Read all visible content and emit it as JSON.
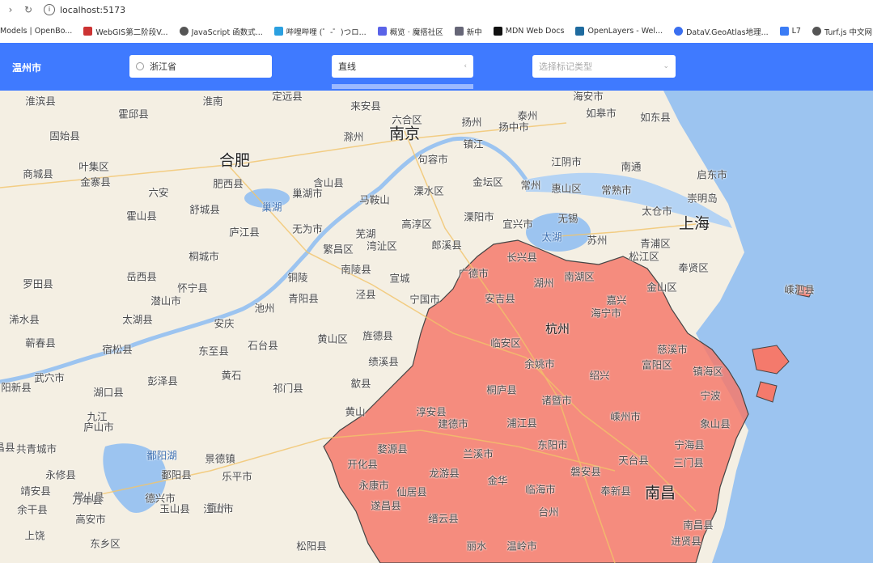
{
  "browser": {
    "url": "localhost:5173",
    "bookmarks": [
      "Models | OpenBo...",
      "WebGIS第二阶段V...",
      "JavaScript 函数式...",
      "哔哩哔哩 (゜-゜)つロ...",
      "概览 · 魔搭社区",
      "新中",
      "MDN Web Docs",
      "OpenLayers - Wel...",
      "DataV.GeoAtlas地理...",
      "L7",
      "Turf.js 中文网"
    ]
  },
  "header": {
    "city": "温州市",
    "search_value": "浙江省",
    "draw_type": "直线",
    "mark_placeholder": "选择标记类型"
  },
  "map": {
    "highlight_region": "浙江省",
    "highlight_color": "#f47a6c",
    "sea_color": "#9cc4f0",
    "labels": [
      {
        "t": "淮滨县",
        "c": "s"
      },
      {
        "t": "淮南",
        "c": "s"
      },
      {
        "t": "定远县",
        "c": "s"
      },
      {
        "t": "来安县",
        "c": "s"
      },
      {
        "t": "六合区",
        "c": "s"
      },
      {
        "t": "泰州",
        "c": "s"
      },
      {
        "t": "海安市",
        "c": "s"
      },
      {
        "t": "霍邱县",
        "c": "s"
      },
      {
        "t": "扬州",
        "c": "s"
      },
      {
        "t": "如皋市",
        "c": "s"
      },
      {
        "t": "固始县",
        "c": "s"
      },
      {
        "t": "滁州",
        "c": "s"
      },
      {
        "t": "南京",
        "c": "b"
      },
      {
        "t": "扬中市",
        "c": "s"
      },
      {
        "t": "如东县",
        "c": "s"
      },
      {
        "t": "镇江",
        "c": "s"
      },
      {
        "t": "合肥",
        "c": "b"
      },
      {
        "t": "叶集区",
        "c": "s"
      },
      {
        "t": "句容市",
        "c": "s"
      },
      {
        "t": "江阴市",
        "c": "s"
      },
      {
        "t": "南通",
        "c": "s"
      },
      {
        "t": "商城县",
        "c": "s"
      },
      {
        "t": "金寨县",
        "c": "s"
      },
      {
        "t": "肥西县",
        "c": "s"
      },
      {
        "t": "含山县",
        "c": "s"
      },
      {
        "t": "金坛区",
        "c": "s"
      },
      {
        "t": "常州",
        "c": "s"
      },
      {
        "t": "惠山区",
        "c": "s"
      },
      {
        "t": "常熟市",
        "c": "s"
      },
      {
        "t": "启东市",
        "c": "s"
      },
      {
        "t": "六安",
        "c": "s"
      },
      {
        "t": "巢湖市",
        "c": "s"
      },
      {
        "t": "马鞍山",
        "c": "s"
      },
      {
        "t": "溧水区",
        "c": "s"
      },
      {
        "t": "崇明岛",
        "c": "s"
      },
      {
        "t": "巢湖",
        "c": "w"
      },
      {
        "t": "霍山县",
        "c": "s"
      },
      {
        "t": "舒城县",
        "c": "s"
      },
      {
        "t": "无为市",
        "c": "s"
      },
      {
        "t": "高淳区",
        "c": "s"
      },
      {
        "t": "溧阳市",
        "c": "s"
      },
      {
        "t": "宜兴市",
        "c": "s"
      },
      {
        "t": "无锡",
        "c": "s"
      },
      {
        "t": "太仓市",
        "c": "s"
      },
      {
        "t": "上海",
        "c": "b"
      },
      {
        "t": "芜湖",
        "c": "s"
      },
      {
        "t": "太湖",
        "c": "w"
      },
      {
        "t": "苏州",
        "c": "s"
      },
      {
        "t": "庐江县",
        "c": "s"
      },
      {
        "t": "繁昌区",
        "c": "s"
      },
      {
        "t": "湾沚区",
        "c": "s"
      },
      {
        "t": "郎溪县",
        "c": "s"
      },
      {
        "t": "青浦区",
        "c": "s"
      },
      {
        "t": "松江区",
        "c": "s"
      },
      {
        "t": "桐城市",
        "c": "s"
      },
      {
        "t": "长兴县",
        "c": "s"
      },
      {
        "t": "南湖区",
        "c": "s"
      },
      {
        "t": "奉贤区",
        "c": "s"
      },
      {
        "t": "南陵县",
        "c": "s"
      },
      {
        "t": "广德市",
        "c": "s"
      },
      {
        "t": "岳西县",
        "c": "s"
      },
      {
        "t": "铜陵",
        "c": "s"
      },
      {
        "t": "宣城",
        "c": "s"
      },
      {
        "t": "湖州",
        "c": "s"
      },
      {
        "t": "金山区",
        "c": "s"
      },
      {
        "t": "罗田县",
        "c": "s"
      },
      {
        "t": "怀宁县",
        "c": "s"
      },
      {
        "t": "潜山市",
        "c": "s"
      },
      {
        "t": "青阳县",
        "c": "s"
      },
      {
        "t": "泾县",
        "c": "s"
      },
      {
        "t": "宁国市",
        "c": "s"
      },
      {
        "t": "安吉县",
        "c": "s"
      },
      {
        "t": "嘉兴",
        "c": "s"
      },
      {
        "t": "嵊泗县",
        "c": "s"
      },
      {
        "t": "池州",
        "c": "s"
      },
      {
        "t": "海宁市",
        "c": "s"
      },
      {
        "t": "浠水县",
        "c": "s"
      },
      {
        "t": "太湖县",
        "c": "s"
      },
      {
        "t": "安庆",
        "c": "s"
      },
      {
        "t": "黄山区",
        "c": "s"
      },
      {
        "t": "旌德县",
        "c": "s"
      },
      {
        "t": "杭州",
        "c": "m"
      },
      {
        "t": "蕲春县",
        "c": "s"
      },
      {
        "t": "宿松县",
        "c": "s"
      },
      {
        "t": "东至县",
        "c": "s"
      },
      {
        "t": "石台县",
        "c": "s"
      },
      {
        "t": "临安区",
        "c": "s"
      },
      {
        "t": "慈溪市",
        "c": "s"
      },
      {
        "t": "绩溪县",
        "c": "s"
      },
      {
        "t": "富阳区",
        "c": "s"
      },
      {
        "t": "余姚市",
        "c": "s"
      },
      {
        "t": "绍兴",
        "c": "s"
      },
      {
        "t": "镇海区",
        "c": "s"
      },
      {
        "t": "黄石",
        "c": "s"
      },
      {
        "t": "武穴市",
        "c": "s"
      },
      {
        "t": "彭泽县",
        "c": "s"
      },
      {
        "t": "祁门县",
        "c": "s"
      },
      {
        "t": "歙县",
        "c": "s"
      },
      {
        "t": "阳新县",
        "c": "s"
      },
      {
        "t": "湖口县",
        "c": "s"
      },
      {
        "t": "桐庐县",
        "c": "s"
      },
      {
        "t": "诸暨市",
        "c": "s"
      },
      {
        "t": "宁波",
        "c": "s"
      },
      {
        "t": "黄山",
        "c": "s"
      },
      {
        "t": "九江",
        "c": "s"
      },
      {
        "t": "淳安县",
        "c": "s"
      },
      {
        "t": "嵊州市",
        "c": "s"
      },
      {
        "t": "象山县",
        "c": "s"
      },
      {
        "t": "庐山市",
        "c": "s"
      },
      {
        "t": "建德市",
        "c": "s"
      },
      {
        "t": "浦江县",
        "c": "s"
      },
      {
        "t": "共青城市",
        "c": "s"
      },
      {
        "t": "昌县",
        "c": "s"
      },
      {
        "t": "鄱阳湖",
        "c": "w"
      },
      {
        "t": "景德镇",
        "c": "s"
      },
      {
        "t": "婺源县",
        "c": "s"
      },
      {
        "t": "兰溪市",
        "c": "s"
      },
      {
        "t": "东阳市",
        "c": "s"
      },
      {
        "t": "宁海县",
        "c": "s"
      },
      {
        "t": "永修县",
        "c": "s"
      },
      {
        "t": "鄱阳县",
        "c": "s"
      },
      {
        "t": "乐平市",
        "c": "s"
      },
      {
        "t": "开化县",
        "c": "s"
      },
      {
        "t": "龙游县",
        "c": "s"
      },
      {
        "t": "金华",
        "c": "s"
      },
      {
        "t": "磐安县",
        "c": "s"
      },
      {
        "t": "天台县",
        "c": "s"
      },
      {
        "t": "三门县",
        "c": "s"
      },
      {
        "t": "靖安县",
        "c": "s"
      },
      {
        "t": "常山县",
        "c": "s"
      },
      {
        "t": "德兴市",
        "c": "s"
      },
      {
        "t": "衢州",
        "c": "s"
      },
      {
        "t": "永康市",
        "c": "s"
      },
      {
        "t": "仙居县",
        "c": "s"
      },
      {
        "t": "临海市",
        "c": "s"
      },
      {
        "t": "奉新县",
        "c": "s"
      },
      {
        "t": "南昌",
        "c": "b"
      },
      {
        "t": "余干县",
        "c": "s"
      },
      {
        "t": "万年县",
        "c": "s"
      },
      {
        "t": "玉山县",
        "c": "s"
      },
      {
        "t": "江山市",
        "c": "s"
      },
      {
        "t": "缙云县",
        "c": "s"
      },
      {
        "t": "遂昌县",
        "c": "s"
      },
      {
        "t": "台州",
        "c": "s"
      },
      {
        "t": "南昌县",
        "c": "s"
      },
      {
        "t": "高安市",
        "c": "s"
      },
      {
        "t": "上饶",
        "c": "s"
      },
      {
        "t": "松阳县",
        "c": "s"
      },
      {
        "t": "丽水",
        "c": "s"
      },
      {
        "t": "温岭市",
        "c": "s"
      },
      {
        "t": "进贤县",
        "c": "s"
      },
      {
        "t": "东乡区",
        "c": "s"
      }
    ]
  }
}
